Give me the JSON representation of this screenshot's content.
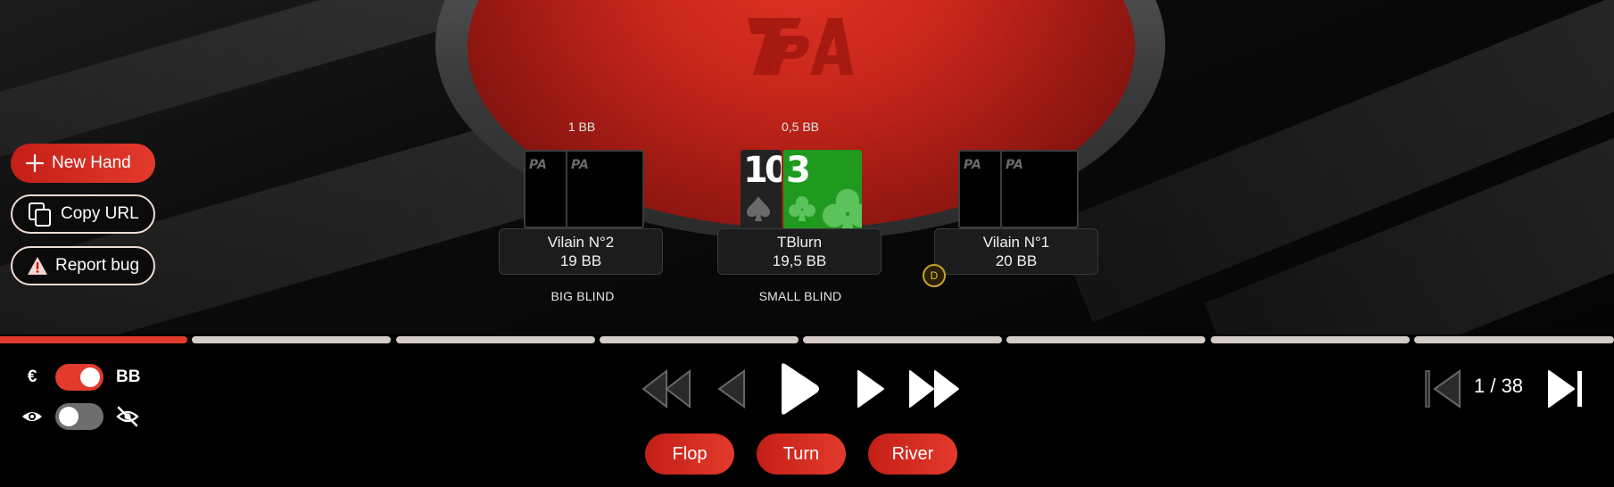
{
  "table": {
    "logo_text": "PA",
    "bets": {
      "left": "1 BB",
      "center": "0,5 BB"
    },
    "seats": [
      {
        "name": "Vilain N°2",
        "stack": "19 BB",
        "position": "BIG BLIND"
      },
      {
        "name": "TBlurn",
        "stack": "19,5 BB",
        "position": "SMALL BLIND"
      },
      {
        "name": "Vilain N°1",
        "stack": "20 BB",
        "position": ""
      }
    ],
    "hero_cards": [
      {
        "rank": "10",
        "suit": "spade",
        "color": "#222222"
      },
      {
        "rank": "3",
        "suit": "club",
        "color": "#1f9a1f"
      }
    ],
    "card_back_logo": "PA",
    "dealer_button": "D"
  },
  "sidebar": {
    "new_hand": "New Hand",
    "copy_url": "Copy URL",
    "report_bug": "Report bug"
  },
  "progress": {
    "current_step": 1,
    "total_steps": 38,
    "segments": 8
  },
  "settings": {
    "currency_symbol": "€",
    "unit_label": "BB",
    "bb_toggle_on": true,
    "visibility_toggle_on": false
  },
  "playback": {
    "counter": "1 / 38",
    "icons": [
      "rewind-icon",
      "step-back-icon",
      "play-icon",
      "step-forward-icon",
      "fast-forward-icon",
      "skip-to-start-icon",
      "skip-to-end-icon"
    ]
  },
  "streets": {
    "flop": "Flop",
    "turn": "Turn",
    "river": "River"
  },
  "colors": {
    "accent": "#e23a2c",
    "felt": "#c9261b",
    "segment": "#d6ccc7",
    "dealer": "#c9a227"
  }
}
